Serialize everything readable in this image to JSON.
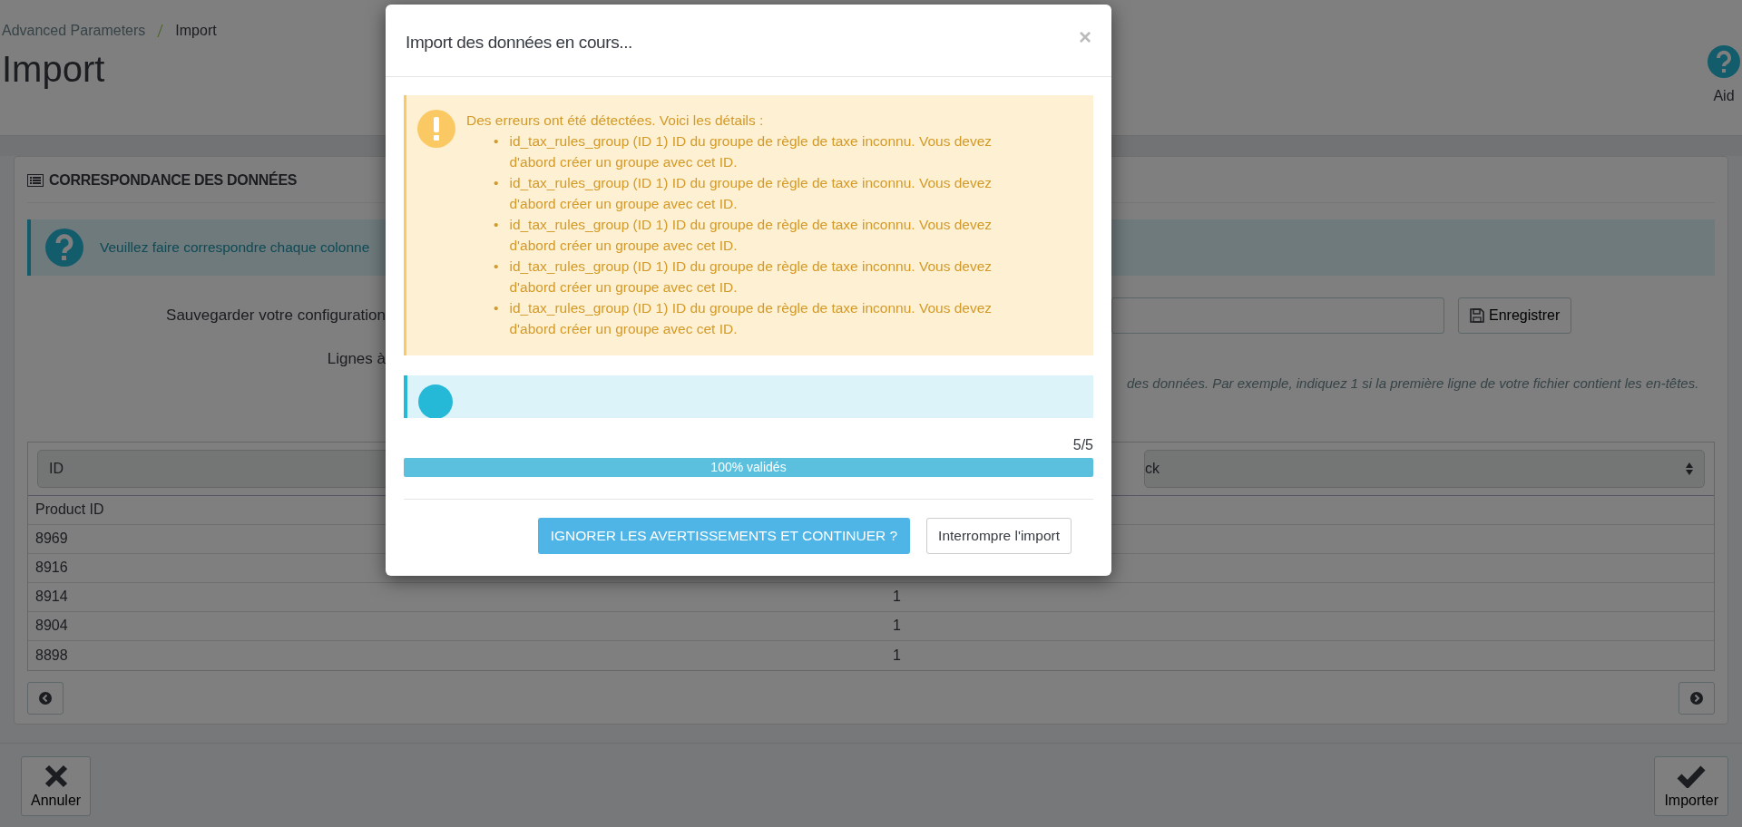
{
  "breadcrumb": {
    "items": [
      "Advanced Parameters",
      "Import"
    ]
  },
  "page_title": "Import",
  "help_button": {
    "label": "Aid"
  },
  "panel": {
    "title": "CORRESPONDANCE DES DONNÉES",
    "info": "Veuillez faire correspondre chaque colonne",
    "save_label": "Sauvegarder votre configuration",
    "save_button": "Enregistrer",
    "skip_label": "Lignes à",
    "skip_help": "des données. Par exemple, indiquez 1 si la première ligne de votre fichier contient les en-têtes.",
    "table": {
      "selects": [
        "ID",
        "ck"
      ],
      "rows": [
        [
          "Product ID"
        ],
        [
          "8969"
        ],
        [
          "8916"
        ],
        [
          "8914",
          "1"
        ],
        [
          "8904",
          "1"
        ],
        [
          "8898",
          "1"
        ]
      ]
    }
  },
  "footer": {
    "cancel": "Annuler",
    "import": "Importer"
  },
  "modal": {
    "title": "Import des données en cours...",
    "close": "×",
    "warning": {
      "intro": "Des erreurs ont été détectées. Voici les détails :",
      "marker": "•",
      "items": [
        "id_tax_rules_group (ID 1) ID du groupe de règle de taxe inconnu. Vous devez d'abord créer un groupe avec cet ID.",
        "id_tax_rules_group (ID 1) ID du groupe de règle de taxe inconnu. Vous devez d'abord créer un groupe avec cet ID.",
        "id_tax_rules_group (ID 1) ID du groupe de règle de taxe inconnu. Vous devez d'abord créer un groupe avec cet ID.",
        "id_tax_rules_group (ID 1) ID du groupe de règle de taxe inconnu. Vous devez d'abord créer un groupe avec cet ID.",
        "id_tax_rules_group (ID 1) ID du groupe de règle de taxe inconnu. Vous devez d'abord créer un groupe avec cet ID."
      ]
    },
    "count": "5/5",
    "progress": {
      "level": 1,
      "label": "100% validés"
    },
    "buttons": [
      {
        "label": "IGNORER LES AVERTISSEMENTS ET CONTINUER ?",
        "kind": "primary"
      },
      {
        "label": "Interrompre l'import",
        "kind": "default"
      }
    ]
  }
}
